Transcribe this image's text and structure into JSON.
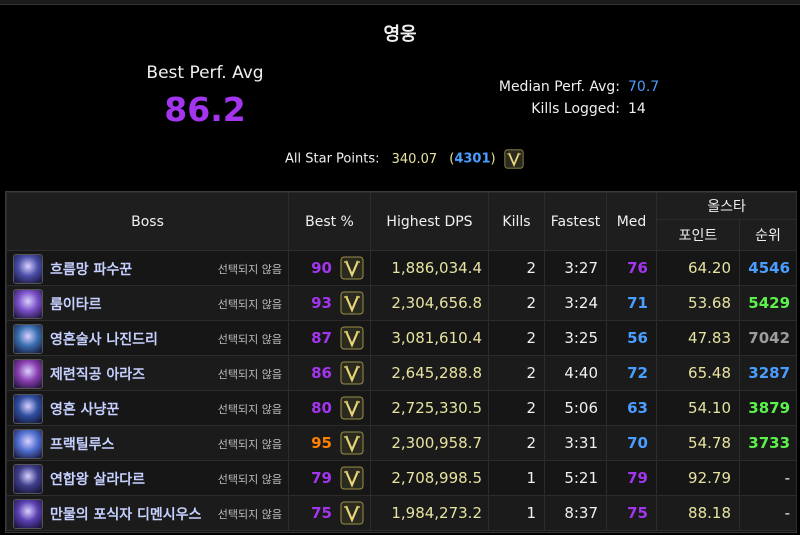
{
  "header": {
    "difficulty": "영웅",
    "best_perf_label": "Best Perf. Avg",
    "best_perf_value": "86.2",
    "median_label": "Median Perf. Avg:",
    "median_value": "70.7",
    "kills_label": "Kills Logged:",
    "kills_value": "14",
    "allstar_label": "All Star Points:",
    "allstar_points": "340.07",
    "allstar_rank": "4301"
  },
  "table": {
    "headers": {
      "boss": "Boss",
      "best": "Best %",
      "dps": "Highest DPS",
      "kills": "Kills",
      "fastest": "Fastest",
      "med": "Med",
      "allstar": "올스타",
      "points": "포인트",
      "rank": "순위"
    },
    "rows": [
      {
        "name": "흐름망 파수꾼",
        "option": "선택되지 않음",
        "best": "90",
        "best_color": "#a335ee",
        "dps": "1,886,034.4",
        "kills": "2",
        "fastest": "3:27",
        "med": "76",
        "med_color": "#a335ee",
        "points": "64.20",
        "rank": "4546",
        "rank_color": "#4a9eff",
        "icon_color": "#4b4fa8"
      },
      {
        "name": "룸이타르",
        "option": "선택되지 않음",
        "best": "93",
        "best_color": "#a335ee",
        "dps": "2,304,656.8",
        "kills": "2",
        "fastest": "3:24",
        "med": "71",
        "med_color": "#4a9eff",
        "points": "53.68",
        "rank": "5429",
        "rank_color": "#5cf24c",
        "icon_color": "#7a4fc7"
      },
      {
        "name": "영혼술사 나진드리",
        "option": "선택되지 않음",
        "best": "87",
        "best_color": "#a335ee",
        "dps": "3,081,610.4",
        "kills": "2",
        "fastest": "3:25",
        "med": "56",
        "med_color": "#4a9eff",
        "points": "47.83",
        "rank": "7042",
        "rank_color": "#9d9d9d",
        "icon_color": "#3a6fb0"
      },
      {
        "name": "제련직공 아라즈",
        "option": "선택되지 않음",
        "best": "86",
        "best_color": "#a335ee",
        "dps": "2,645,288.8",
        "kills": "2",
        "fastest": "4:40",
        "med": "72",
        "med_color": "#4a9eff",
        "points": "65.48",
        "rank": "3287",
        "rank_color": "#4a9eff",
        "icon_color": "#8a3fb0"
      },
      {
        "name": "영혼 사냥꾼",
        "option": "선택되지 않음",
        "best": "80",
        "best_color": "#a335ee",
        "dps": "2,725,330.5",
        "kills": "2",
        "fastest": "5:06",
        "med": "63",
        "med_color": "#4a9eff",
        "points": "54.10",
        "rank": "3879",
        "rank_color": "#5cf24c",
        "icon_color": "#2f4fa0"
      },
      {
        "name": "프랙틸루스",
        "option": "선택되지 않음",
        "best": "95",
        "best_color": "#ff8000",
        "dps": "2,300,958.7",
        "kills": "2",
        "fastest": "3:31",
        "med": "70",
        "med_color": "#4a9eff",
        "points": "54.78",
        "rank": "3733",
        "rank_color": "#5cf24c",
        "icon_color": "#4f6fd0"
      },
      {
        "name": "연합왕 살라다르",
        "option": "선택되지 않음",
        "best": "79",
        "best_color": "#a335ee",
        "dps": "2,708,998.5",
        "kills": "1",
        "fastest": "5:21",
        "med": "79",
        "med_color": "#a335ee",
        "points": "92.79",
        "rank": "-",
        "rank_color": "#f0f0f0",
        "icon_color": "#3f3f8a"
      },
      {
        "name": "만물의 포식자 디멘시우스",
        "option": "선택되지 않음",
        "best": "75",
        "best_color": "#a335ee",
        "dps": "1,984,273.2",
        "kills": "1",
        "fastest": "8:37",
        "med": "75",
        "med_color": "#a335ee",
        "points": "88.18",
        "rank": "-",
        "rank_color": "#f0f0f0",
        "icon_color": "#5a3fb0"
      }
    ]
  }
}
